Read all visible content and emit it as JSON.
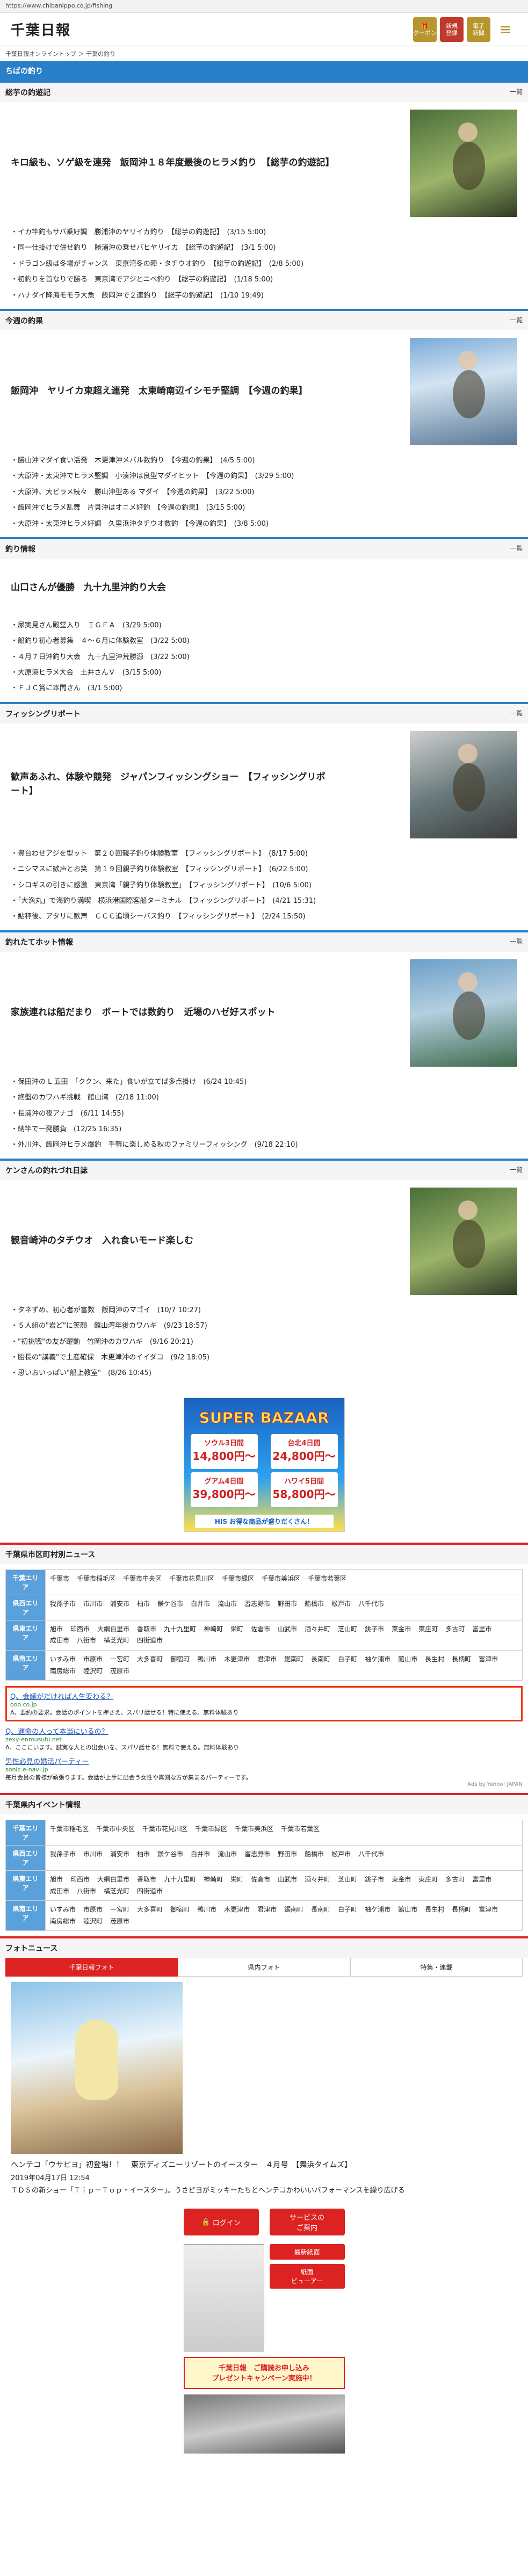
{
  "url": "https://www.chibanippo.co.jp/fishing",
  "header": {
    "logo": "千葉日報",
    "btn_coupon": "クーポン",
    "btn_new": "新規\n登録",
    "btn_paper": "電子\n新聞",
    "menu_icon": "≡"
  },
  "breadcrumb": "千葉日報オンライントップ ＞ 千葉の釣り",
  "page_title": "ちばの釣り",
  "more_label": "一覧",
  "sections": [
    {
      "title": "総芋の釣遊記",
      "feature": "キロ級も、ソゲ級を連発　飯岡沖１８年度最後のヒラメ釣り　【総芋の釣遊記】",
      "items": [
        "イカ竿釣もサバ乗好調　勝浦沖のヤリイカ釣り　【総芋の釣遊記】　(3/15 5:00)",
        "同一仕掛けで併せ釣り　勝浦沖の乗せバヒヤリイカ　【総芋の釣遊記】　(3/1 5:00)",
        "ドラゴン級は冬場がチャンス　東京湾冬の陣・タチウオ釣り　【総芋の釣遊記】　(2/8 5:00)",
        "初釣りを首なりで勝る　東京湾でアジとニベ釣り　【総芋の釣遊記】　(1/18 5:00)",
        "ハナダイ降海モモラ大魚　飯岡沖で２連釣り　【総芋の釣遊記】　(1/10 19:49)"
      ]
    },
    {
      "title": "今週の釣果",
      "feature": "飯岡沖　ヤリイカ束超え連発　太東崎南辺イシモチ堅調　【今週の釣果】",
      "items": [
        "勝山沖マダイ食い活発　木更津沖メバル数釣り　【今週の釣果】　(4/5 5:00)",
        "大原沖・太東沖でヒラメ堅調　小湊沖は良型マダイヒット　【今週の釣果】　(3/29 5:00)",
        "大原沖、大ビラメ続々　勝山沖型ある マダイ　【今週の釣果】　(3/22 5:00)",
        "飯岡沖でヒラメ乱舞　片貝沖はオニメ好釣　【今週の釣果】　(3/15 5:00)",
        "大原沖・太東沖ヒラメ好調　久里浜沖タチウオ数釣　【今週の釣果】　(3/8 5:00)"
      ]
    },
    {
      "title": "釣り情報",
      "feature": "山口さんが優勝　九十九里沖釣り大会",
      "items": [
        "尿実見さん殿堂入り　ＩＧＦＡ　(3/29 5:00)",
        "船釣り初心者募集　４～６月に体験教室　(3/22 5:00)",
        "４月７日沖釣り大会　九十九里沖荒勝源　(3/22 5:00)",
        "大原港ヒラメ大会　土井さんＶ　(3/15 5:00)",
        "ＦＪＣ賞に本間さん　(3/1 5:00)"
      ]
    },
    {
      "title": "フィッシングリポート",
      "feature": "歓声あふれ、体験や競発　ジャパンフィッシングショー　【フィッシングリポート】",
      "items": [
        "豊台わせアジを型ット　第２０回親子釣り体験教室　【フィッシングリポート】　(8/17 5:00)",
        "ニシマスに歓声とお笑　第１９回親子釣り体験教室　【フィッシングリポート】　(6/22 5:00)",
        "シロギスの引きに感激　東京湾「親子釣り体験教室」　【フィッシングリポート】　(10/6 5:00)",
        "「大漁丸」で海釣り満喫　横浜港国際客船ターミナル　【フィッシングリポート】　(4/21 15:31)",
        "鮎秤後、アタリに歓声　ＣＣＣ追頃シーバス釣り　【フィッシングリポート】　(2/24 15:50)"
      ]
    },
    {
      "title": "釣れたてホット情報",
      "feature": "家族連れは船だまり　ボートでは数釣り　近場のハゼ好スポット",
      "items": [
        "保田沖の L 五田　「ククン、来た」食いが立てば多点掛け　(6/24 10:45)",
        "終盤のカワハギ挑戦　館山湾　(2/18 11:00)",
        "長浦沖の夜アナゴ　(6/11 14:55)",
        "納竿で一発勝負　(12/25 16:35)",
        "外川沖、飯岡沖ヒラメ爆釣　手軽に楽しめる秋のファミリーフィッシング　(9/18 22:10)"
      ]
    },
    {
      "title": "ケンさんの釣れづれ日誌",
      "feature": "観音崎沖のタチウオ　入れ食いモード楽しむ",
      "items": [
        "タネずめ、初心者が富数　飯岡沖のマゴイ　(10/7 10:27)",
        "５人組の\"岩ど\"に笑顔　館山湾年後カワハギ　(9/23 18:57)",
        "\"初挑戦\"の友が躍動　竹岡沖のカワハギ　(9/16 20:21)",
        "胎長の\"講義\"で土産確保　木更津沖のイイダコ　(9/2 18:05)",
        "思いおいっぱい\"船上教室\"　(8/26 10:45)"
      ]
    }
  ],
  "ad_banner": {
    "title": "SUPER BAZAAR",
    "deal1": "ソウル3日間",
    "price1": "14,800円～",
    "deal2": "台北4日間",
    "price2": "24,800円～",
    "deal3": "グアム4日間",
    "price3": "39,800円～",
    "deal4": "ハワイ5日間",
    "price4": "58,800円～",
    "footer": "HIS お得な商品が盛りだくさん！"
  },
  "city_news": {
    "title": "千葉県市区町村別ニュース",
    "rows": [
      {
        "label": "千葉エリア",
        "cities": [
          "千葉市",
          "千葉市稲毛区",
          "千葉市中央区",
          "千葉市花見川区",
          "千葉市緑区",
          "千葉市美浜区",
          "千葉市若葉区"
        ]
      },
      {
        "label": "県西エリア",
        "cities": [
          "我孫子市",
          "市川市",
          "浦安市",
          "柏市",
          "鎌ケ谷市",
          "白井市",
          "流山市",
          "習志野市",
          "野田市",
          "船橋市",
          "松戸市",
          "八千代市"
        ]
      },
      {
        "label": "県東エリア",
        "cities": [
          "旭市",
          "印西市",
          "大網白里市",
          "香取市",
          "九十九里町",
          "神崎町",
          "栄町",
          "佐倉市",
          "山武市",
          "酒々井町",
          "芝山町",
          "銚子市",
          "東金市",
          "東庄町",
          "多古町",
          "富里市",
          "成田市",
          "八街市",
          "横芝光町",
          "四街道市"
        ]
      },
      {
        "label": "県南エリア",
        "cities": [
          "いすみ市",
          "市原市",
          "一宮町",
          "大多喜町",
          "御宿町",
          "鴨川市",
          "木更津市",
          "君津市",
          "鋸南町",
          "長南町",
          "白子町",
          "袖ケ浦市",
          "館山市",
          "長生村",
          "長柄町",
          "富津市",
          "南房総市",
          "睦沢町",
          "茂原市"
        ]
      }
    ]
  },
  "yahoo_ads": {
    "ad1_title": "Q、会議がだければ人生変わる？",
    "ad1_url": "ooo.co.jp",
    "ad1_desc": "A、要約の要求。会話のポイントを押さえ、スパリ話せる！特に使える。無料体験あり",
    "ad2_title": "Q、運命の人って本当にいるの？",
    "ad2_url": "zexy-enmusubi.net",
    "ad2_desc": "A、ここにいます。誠実な人との出会いを、スパリ話せる！無料で使える。無料体験あり",
    "ad3_title": "男性必見の婚活パーティー",
    "ad3_url": "sonic.e-navi.jp",
    "ad3_desc": "毎月会員の皆様が頑張ります。会話が上手に出会う女性や真剣な方が集まるパーティーです。",
    "credit": "Ads by Yahoo! JAPAN"
  },
  "event_info": {
    "title": "千葉県内イベント情報",
    "rows": [
      {
        "label": "千葉エリア",
        "cities": [
          "千葉市稲毛区",
          "千葉市中央区",
          "千葉市花見川区",
          "千葉市緑区",
          "千葉市美浜区",
          "千葉市若葉区"
        ]
      },
      {
        "label": "県西エリア",
        "cities": [
          "我孫子市",
          "市川市",
          "浦安市",
          "柏市",
          "鎌ケ谷市",
          "白井市",
          "流山市",
          "習志野市",
          "野田市",
          "船橋市",
          "松戸市",
          "八千代市"
        ]
      },
      {
        "label": "県東エリア",
        "cities": [
          "旭市",
          "印西市",
          "大網白里市",
          "香取市",
          "九十九里町",
          "神崎町",
          "栄町",
          "佐倉市",
          "山武市",
          "酒々井町",
          "芝山町",
          "銚子市",
          "東金市",
          "東庄町",
          "多古町",
          "富里市",
          "成田市",
          "八街市",
          "横芝光町",
          "四街道市"
        ]
      },
      {
        "label": "県南エリア",
        "cities": [
          "いすみ市",
          "市原市",
          "一宮町",
          "大多喜町",
          "御宿町",
          "鴨川市",
          "木更津市",
          "君津市",
          "鋸南町",
          "長南町",
          "白子町",
          "袖ケ浦市",
          "館山市",
          "長生村",
          "長柄町",
          "富津市",
          "南房総市",
          "睦沢町",
          "茂原市"
        ]
      }
    ]
  },
  "photo_news": {
    "title": "フォトニュース",
    "tabs": [
      "千葉日報フォト",
      "県内フォト",
      "特集・連載"
    ],
    "caption_title": "ヘンテコ「ウサピヨ」初登場！！　東京ディズニーリゾートのイースター　４月号　【舞浜タイムズ】",
    "date": "2019年04月17日 12:54",
    "body": "ＴＤＳの新ショー「Ｔｉｐ－Ｔｏｐ・イースター」。うさピヨがミッキーたちとヘンテコかわいいパフォーマンスを繰り広げる"
  },
  "buttons": {
    "login": "ログイン",
    "service": "サービスの\nご案内",
    "latest": "最新紙面",
    "viewer": "紙面\nビューアー"
  },
  "promo": "千葉日報　ご購読お申し込み\nプレゼントキャンペーン実施中！"
}
